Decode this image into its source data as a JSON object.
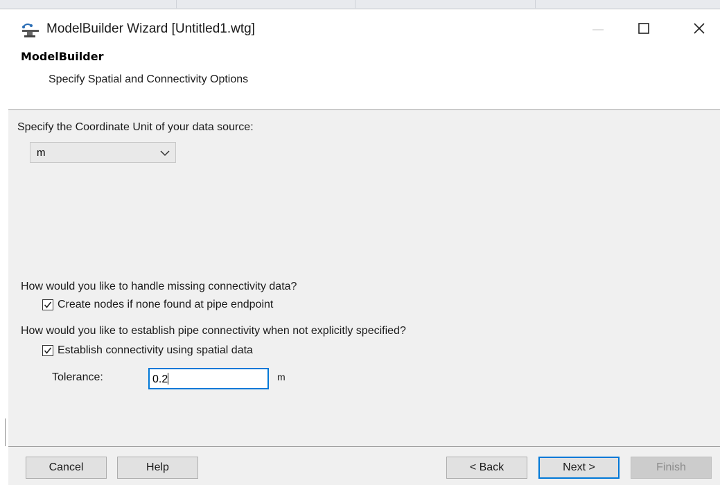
{
  "window": {
    "title": "ModelBuilder Wizard [Untitled1.wtg]",
    "minimize_glyph": "—",
    "maximize_glyph": "☐",
    "close_glyph": "✕"
  },
  "header": {
    "title": "ModelBuilder",
    "subtitle": "Specify Spatial and Connectivity Options"
  },
  "coordinate_unit": {
    "label": "Specify the Coordinate Unit of your data source:",
    "selected": "m",
    "icon": "chevron-down-icon"
  },
  "missing_connectivity": {
    "question": "How would you like to handle missing connectivity data?",
    "checkbox_label": "Create nodes if none found at pipe endpoint",
    "checked": true
  },
  "pipe_connectivity": {
    "question": "How would you like to establish pipe connectivity when not explicitly specified?",
    "checkbox_label": "Establish connectivity using spatial data",
    "checked": true,
    "tolerance_label": "Tolerance:",
    "tolerance_value": "0.2",
    "tolerance_unit": "m"
  },
  "buttons": {
    "cancel": "Cancel",
    "help": "Help",
    "back": "< Back",
    "next": "Next >",
    "finish": "Finish"
  },
  "colors": {
    "focus_accent": "#0078d7",
    "panel_bg": "#f0f0f0",
    "disabled_text": "#8a8a8a"
  }
}
